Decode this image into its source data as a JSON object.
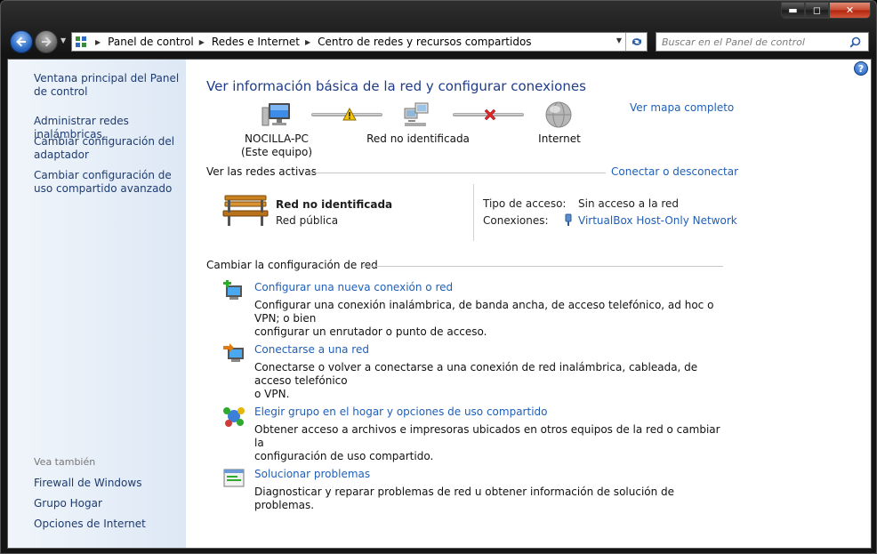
{
  "window": {
    "caption_buttons": {
      "minimize": "▬",
      "maximize": "◻",
      "close": "✕"
    }
  },
  "address_bar": {
    "breadcrumbs": [
      "Panel de control",
      "Redes e Internet",
      "Centro de redes y recursos compartidos"
    ]
  },
  "search": {
    "placeholder": "Buscar en el Panel de control"
  },
  "sidebar": {
    "links": [
      "Ventana principal del Panel de control",
      "Administrar redes inalámbricas",
      "Cambiar configuración del adaptador",
      "Cambiar configuración de uso compartido avanzado"
    ],
    "see_also_heading": "Vea también",
    "see_also": [
      "Firewall de Windows",
      "Grupo Hogar",
      "Opciones de Internet"
    ]
  },
  "main": {
    "title": "Ver información básica de la red y configurar conexiones",
    "full_map_link": "Ver mapa completo",
    "map": {
      "computer": "NOCILLA-PC",
      "computer_sub": "(Este equipo)",
      "network": "Red no identificada",
      "internet": "Internet"
    },
    "active_networks": {
      "heading": "Ver las redes activas",
      "connect_link": "Conectar o desconectar",
      "network_name": "Red no identificada",
      "network_type": "Red pública",
      "access_label": "Tipo de acceso:",
      "access_value": "Sin acceso a la red",
      "connections_label": "Conexiones:",
      "connections_value": "VirtualBox Host-Only Network"
    },
    "change_settings": {
      "heading": "Cambiar la configuración de red",
      "tasks": [
        {
          "title": "Configurar una nueva conexión o red",
          "desc_line1": "Configurar una conexión inalámbrica, de banda ancha, de acceso telefónico, ad hoc o VPN; o bien",
          "desc_line2": "configurar un enrutador o punto de acceso."
        },
        {
          "title": "Conectarse a una red",
          "desc_line1": "Conectarse o volver a conectarse a una conexión de red inalámbrica, cableada, de acceso telefónico",
          "desc_line2": "o VPN."
        },
        {
          "title": "Elegir grupo en el hogar y opciones de uso compartido",
          "desc_line1": "Obtener acceso a archivos e impresoras ubicados en otros equipos de la red o cambiar la",
          "desc_line2": "configuración de uso compartido."
        },
        {
          "title": "Solucionar problemas",
          "desc_line1": "Diagnosticar y reparar problemas de red u obtener información de solución de problemas.",
          "desc_line2": ""
        }
      ]
    }
  },
  "colors": {
    "link": "#1f5fb8",
    "title": "#1e3c8c",
    "sidebar_link": "#1e3b70",
    "warning": "#f2c40c",
    "error": "#d9252b"
  }
}
